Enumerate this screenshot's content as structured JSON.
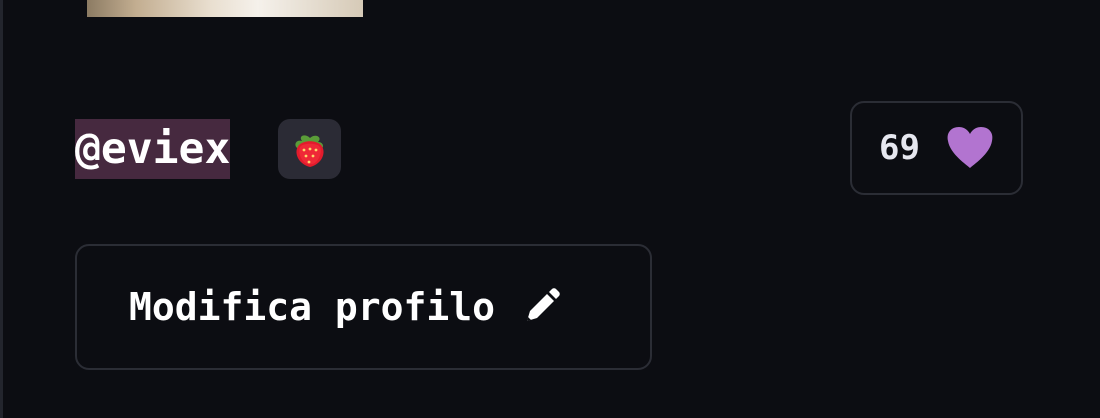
{
  "profile": {
    "username": "@eviex",
    "badge_icon": "strawberry-icon",
    "likes": {
      "count": "69",
      "icon": "heart-icon",
      "color": "#b274d0"
    }
  },
  "actions": {
    "edit_profile_label": "Modifica profilo",
    "edit_icon": "pencil-icon"
  },
  "theme": {
    "background": "#0c0d12",
    "username_highlight": "#46293f",
    "border": "#2b2d35"
  }
}
